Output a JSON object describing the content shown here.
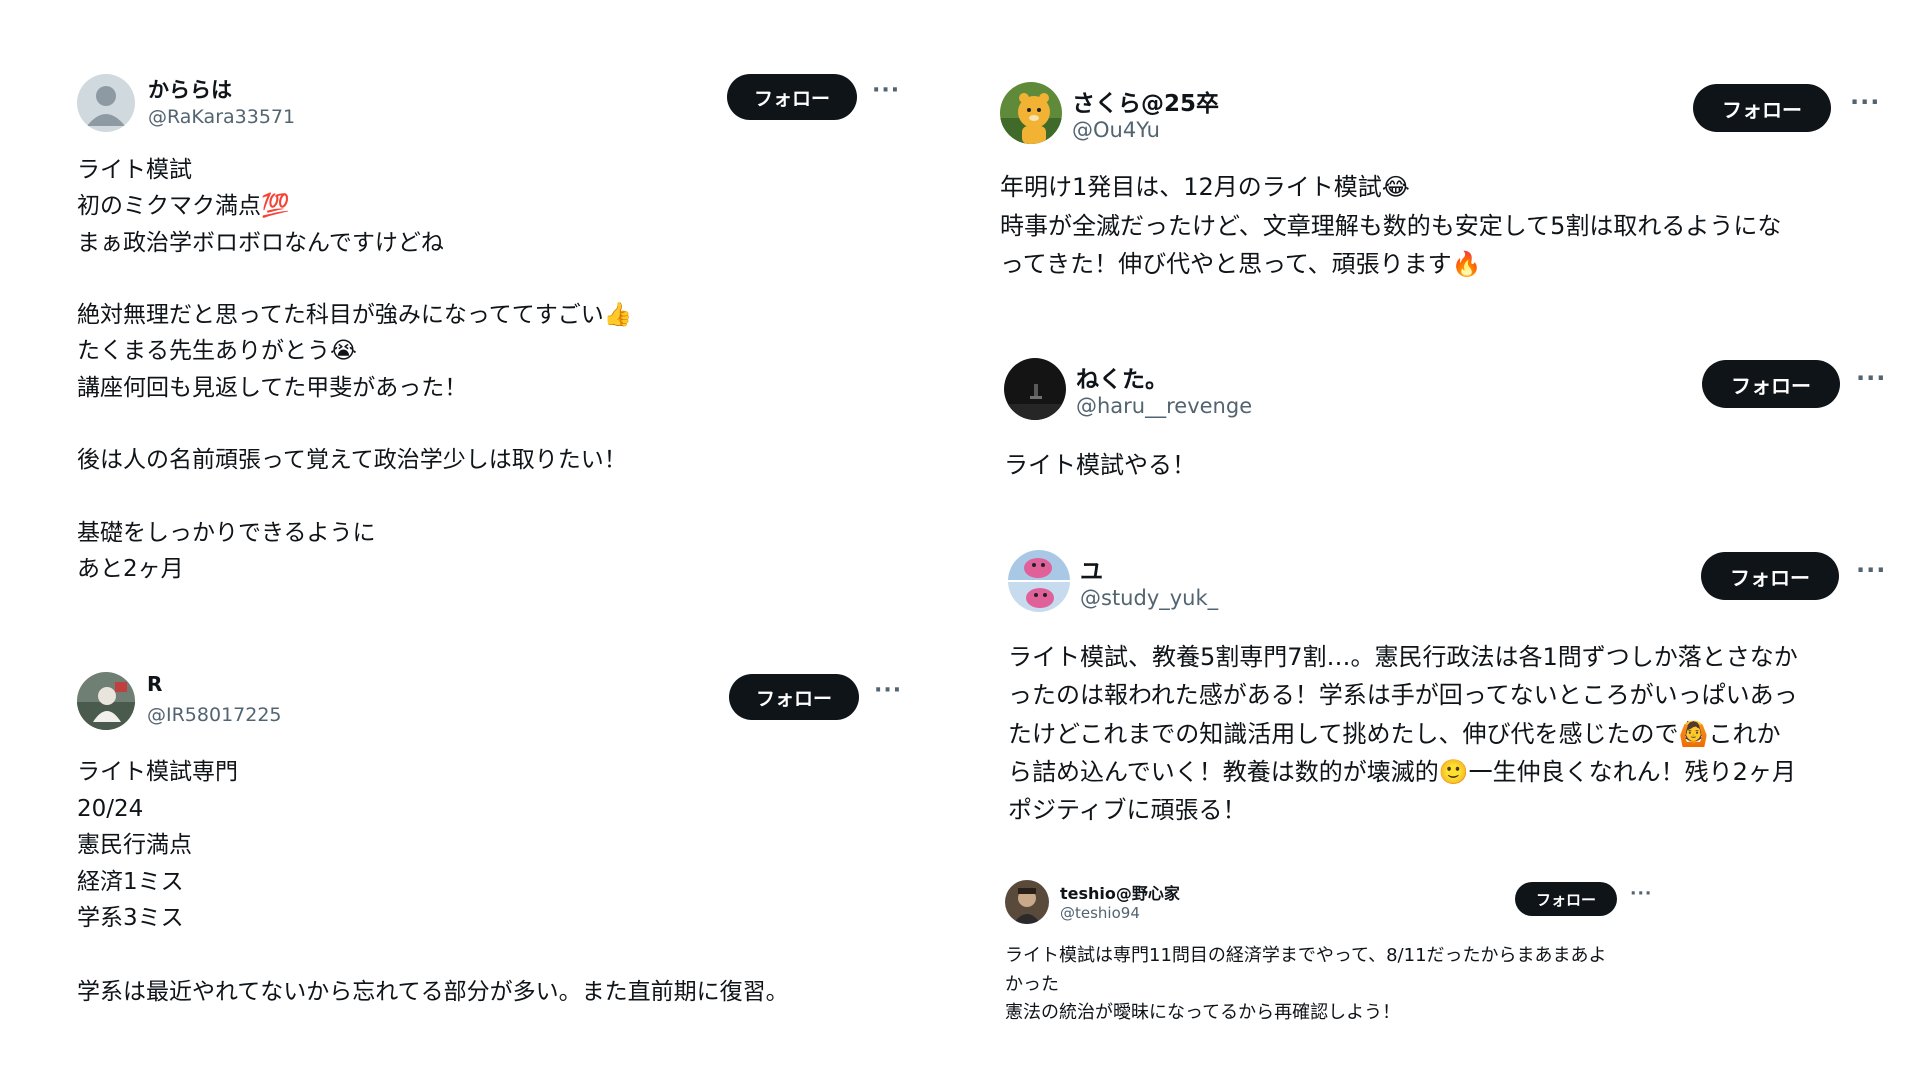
{
  "follow_label": "フォロー",
  "more_label": "···",
  "posts": [
    {
      "name": "かららは",
      "handle": "@RaKara33571",
      "avatar": "default-avatar",
      "text": "ライト模試\n初のミクマク満点💯\nまぁ政治学ボロボロなんですけどね\n\n絶対無理だと思ってた科目が強みになっててすごい👍\nたくまる先生ありがとう😭\n講座何回も見返してた甲斐があった！\n\n後は人の名前頑張って覚えて政治学少しは取りたい！\n\n基礎をしっかりできるように\nあと2ヶ月"
    },
    {
      "name": "R",
      "handle": "@IR58017225",
      "avatar": "photo-avatar",
      "text": "ライト模試専門\n20/24\n憲民行満点\n経済1ミス\n学系3ミス\n\n学系は最近やれてないから忘れてる部分が多い。また直前期に復習。"
    },
    {
      "name": "さくら@25卒",
      "handle": "@Ou4Yu",
      "avatar": "bear-avatar",
      "text": "年明け1発目は、12月のライト模試😂\n時事が全滅だったけど、文章理解も数的も安定して5割は取れるようにな\nってきた！伸び代やと思って、頑張ります🔥"
    },
    {
      "name": "ねくた。",
      "handle": "@haru__revenge",
      "avatar": "dark-photo-avatar",
      "text": "ライト模試やる！"
    },
    {
      "name": "ユ",
      "handle": "@study_yuk_",
      "avatar": "pink-character-avatar",
      "text": "ライト模試、教養5割専門7割…。憲民行政法は各1問ずつしか落とさなか\nったのは報われた感がある！学系は手が回ってないところがいっぱいあっ\nたけどこれまでの知識活用して挑めたし、伸び代を感じたので🙆これか\nら詰め込んでいく！教養は数的が壊滅的🙂一生仲良くなれん！残り2ヶ月\nポジティブに頑張る！"
    },
    {
      "name": "teshio@野心家",
      "handle": "@teshio94",
      "avatar": "person-photo-avatar",
      "text": "ライト模試は専門11問目の経済学までやって、8/11だったからまあまあよ\nかった\n憲法の統治が曖昧になってるから再確認しよう！"
    }
  ]
}
